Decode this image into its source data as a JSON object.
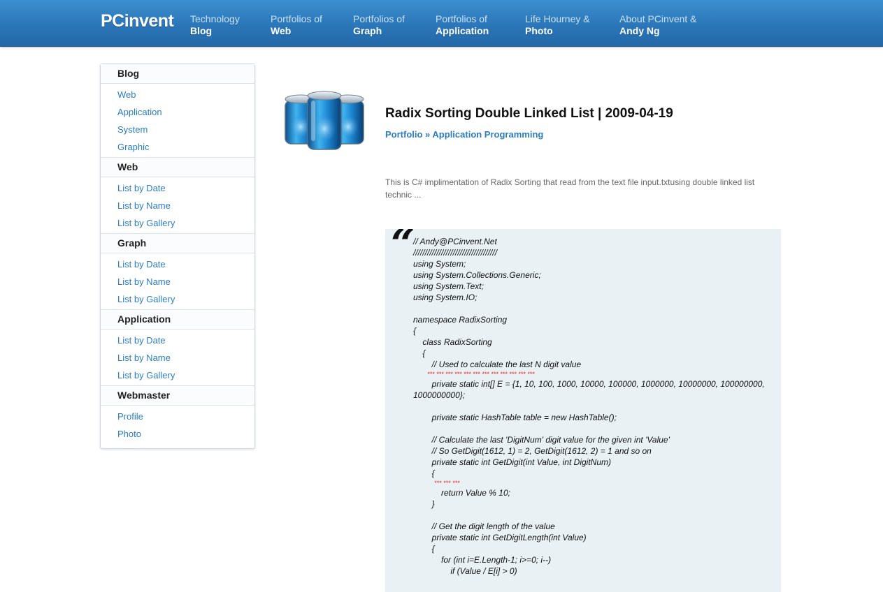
{
  "site": {
    "logo": "PCinvent"
  },
  "nav": [
    {
      "top": "Technology",
      "bottom": "Blog"
    },
    {
      "top": "Portfolios of",
      "bottom": "Web"
    },
    {
      "top": "Portfolios of",
      "bottom": "Graph"
    },
    {
      "top": "Portfolios of",
      "bottom": "Application"
    },
    {
      "top": "Life Hourney &",
      "bottom": "Photo"
    },
    {
      "top": "About PCinvent &",
      "bottom": "Andy Ng"
    }
  ],
  "sidebar": {
    "groups": [
      {
        "title": "Blog",
        "links": [
          "Web",
          "Application",
          "System",
          "Graphic"
        ]
      },
      {
        "title": "Web",
        "links": [
          "List by Date",
          "List by Name",
          "List by Gallery"
        ]
      },
      {
        "title": "Graph",
        "links": [
          "List by Date",
          "List by Name",
          "List by Gallery"
        ]
      },
      {
        "title": "Application",
        "links": [
          "List by Date",
          "List by Name",
          "List by Gallery"
        ]
      },
      {
        "title": "Webmaster",
        "links": [
          "Profile",
          "Photo"
        ]
      }
    ]
  },
  "post": {
    "title": "Radix Sorting Double Linked List | 2009-04-19",
    "breadcrumb_portfolio": "Portfolio",
    "breadcrumb_sep": " » ",
    "breadcrumb_category": "Application Programming",
    "summary": "This is C# implimentation of Radix Sorting that read from the text file input.txtusing double linked list technic ...",
    "quote_mark": "“"
  },
  "colors": {
    "nav_bar": "#2a74b6",
    "link": "#2b7ec1",
    "code_bg": "#e9f1f4",
    "highlight_red": "#e0261c"
  },
  "code_lines": [
    {
      "text": "// Andy@PCinvent.Net",
      "red": false
    },
    {
      "text": "////////////////////////////////////",
      "red": false
    },
    {
      "text": "using System;",
      "red": false
    },
    {
      "text": "using System.Collections.Generic;",
      "red": false
    },
    {
      "text": "using System.Text;",
      "red": false
    },
    {
      "text": "using System.IO;",
      "red": false
    },
    {
      "text": "",
      "red": false
    },
    {
      "text": "namespace RadixSorting",
      "red": false
    },
    {
      "text": "{",
      "red": false
    },
    {
      "text": "    class RadixSorting",
      "red": false
    },
    {
      "text": "    {",
      "red": false
    },
    {
      "text": "        // Used to calculate the last N digit value",
      "red": false
    },
    {
      "text": "        *** *** *** *** *** *** *** *** *** *** *** ***",
      "red": true
    },
    {
      "text": "        private static int[] E = {1, 10, 100, 1000, 10000, 100000, 1000000, 10000000, 100000000, 1000000000};",
      "red": false
    },
    {
      "text": "",
      "red": false
    },
    {
      "text": "        private static HashTable table = new HashTable();",
      "red": false
    },
    {
      "text": "",
      "red": false
    },
    {
      "text": "        // Calculate the last 'DigitNum' digit value for the given int 'Value'",
      "red": false
    },
    {
      "text": "        // So GetDigit(1612, 1) = 2, GetDigit(1612, 2) = 1 and so on",
      "red": false
    },
    {
      "text": "        private static int GetDigit(int Value, int DigitNum)",
      "red": false
    },
    {
      "text": "        {",
      "red": false
    },
    {
      "text": "            *** *** ***",
      "red": true
    },
    {
      "text": "            return Value % 10;",
      "red": false
    },
    {
      "text": "        }",
      "red": false
    },
    {
      "text": "",
      "red": false
    },
    {
      "text": "        // Get the digit length of the value",
      "red": false
    },
    {
      "text": "        private static int GetDigitLength(int Value)",
      "red": false
    },
    {
      "text": "        {",
      "red": false
    },
    {
      "text": "            for (int i=E.Length-1; i>=0; i--)",
      "red": false
    },
    {
      "text": "                if (Value / E[i] > 0)",
      "red": false
    }
  ]
}
